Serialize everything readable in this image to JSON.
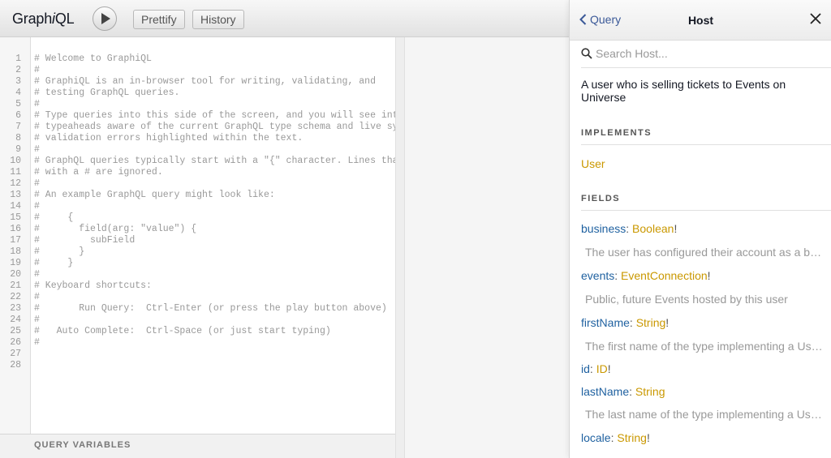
{
  "toolbar": {
    "logo_prefix": "Graph",
    "logo_em": "i",
    "logo_suffix": "QL",
    "prettify_label": "Prettify",
    "history_label": "History"
  },
  "editor": {
    "line_numbers": [
      "1",
      "2",
      "3",
      "4",
      "5",
      "6",
      "7",
      "8",
      "9",
      "10",
      "11",
      "12",
      "13",
      "14",
      "15",
      "16",
      "17",
      "18",
      "19",
      "20",
      "21",
      "22",
      "23",
      "24",
      "25",
      "26",
      "27",
      "28"
    ],
    "lines": [
      "# Welcome to GraphiQL",
      "#",
      "# GraphiQL is an in-browser tool for writing, validating, and",
      "# testing GraphQL queries.",
      "#",
      "# Type queries into this side of the screen, and you will see intel",
      "# typeaheads aware of the current GraphQL type schema and live synt",
      "# validation errors highlighted within the text.",
      "#",
      "# GraphQL queries typically start with a \"{\" character. Lines that",
      "# with a # are ignored.",
      "#",
      "# An example GraphQL query might look like:",
      "#",
      "#     {",
      "#       field(arg: \"value\") {",
      "#         subField",
      "#       }",
      "#     }",
      "#",
      "# Keyboard shortcuts:",
      "#",
      "#       Run Query:  Ctrl-Enter (or press the play button above)",
      "#",
      "#   Auto Complete:  Ctrl-Space (or just start typing)",
      "#",
      "",
      ""
    ],
    "query_variables_label": "QUERY VARIABLES"
  },
  "docs": {
    "back_label": "Query",
    "title": "Host",
    "search_placeholder": "Search Host...",
    "description": "A user who is selling tickets to Events on Universe",
    "implements_title": "IMPLEMENTS",
    "implements": [
      "User"
    ],
    "fields_title": "FIELDS",
    "fields": [
      {
        "name": "business",
        "type": "Boolean",
        "bang": "!",
        "desc": "The user has configured their account as a business"
      },
      {
        "name": "events",
        "type": "EventConnection",
        "bang": "!",
        "desc": "Public, future Events hosted by this user"
      },
      {
        "name": "firstName",
        "type": "String",
        "bang": "!",
        "desc": "The first name of the type implementing a User interface"
      },
      {
        "name": "id",
        "type": "ID",
        "bang": "!",
        "desc": ""
      },
      {
        "name": "lastName",
        "type": "String",
        "bang": "",
        "desc": "The last name of the type implementing a User interface"
      },
      {
        "name": "locale",
        "type": "String",
        "bang": "!",
        "desc": ""
      }
    ]
  },
  "colors": {
    "field_name": "#1F61A0",
    "type_link": "#CA9800",
    "back_link": "#3B5998"
  },
  "icons": {
    "play": "play-icon",
    "back": "chevron-left-icon",
    "close": "close-icon",
    "search": "search-icon"
  }
}
